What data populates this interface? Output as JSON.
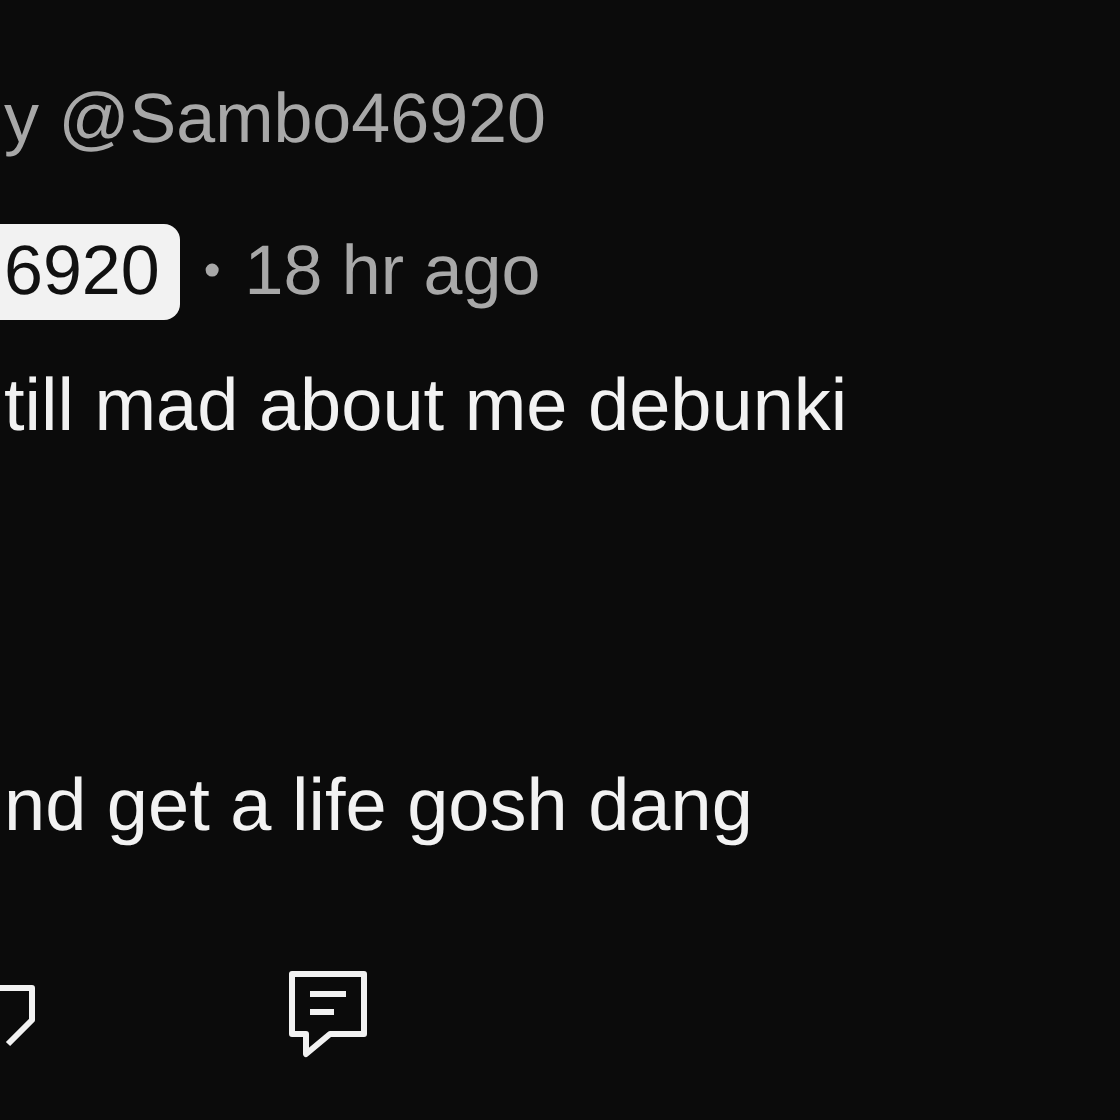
{
  "comment": {
    "reply_to": "y @Sambo46920",
    "author_badge": "6920",
    "separator": "•",
    "time": "18 hr ago",
    "lines": [
      "till mad about me debunki",
      "nd get a life gosh dang"
    ]
  },
  "actions": [
    {
      "kind": "vote"
    },
    {
      "kind": "reply"
    }
  ]
}
